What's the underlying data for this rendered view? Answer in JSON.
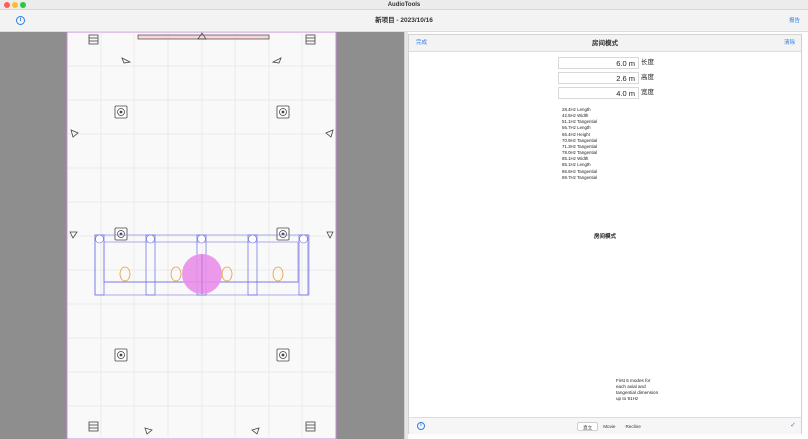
{
  "window": {
    "app_title": "AudioTools"
  },
  "toolbar": {
    "project_title": "新项目  - 2023/10/16",
    "report_label": "报告",
    "info_icon": "info-circle-icon"
  },
  "panel": {
    "done_label": "完成",
    "title": "房间模式",
    "clear_label": "清除",
    "dimensions": [
      {
        "value": "6.0 m",
        "label": "长度"
      },
      {
        "value": "2.6 m",
        "label": "高度"
      },
      {
        "value": "4.0 m",
        "label": "宽度"
      }
    ],
    "modes": [
      "28.4Hz Length",
      "42.5Hz Width",
      "51.1Hz Tangential",
      "56.7Hz Length",
      "65.4Hz Height",
      "70.9Hz Tangential",
      "71.3Hz Tangential",
      "78.0Hz Tangential",
      "85.1Hz Width",
      "85.1Hz Length",
      "86.6Hz Tangential",
      "89.7Hz Tangential"
    ],
    "modes_heading": "房间模式",
    "modes_note": "First 5 modes for each axial and tangential dimension up to 91Hz",
    "footer": {
      "segments": [
        "直立",
        "Movie",
        "Recline"
      ],
      "active_segment": "直立",
      "check_icon": "checkmark-icon"
    }
  },
  "colors": {
    "accent": "#2f7de1",
    "room_border": "#c98ad8",
    "seat_circle": "#e98ee8",
    "speaker_outline": "#6a6ae8",
    "ear_outline": "#e0a13a"
  }
}
